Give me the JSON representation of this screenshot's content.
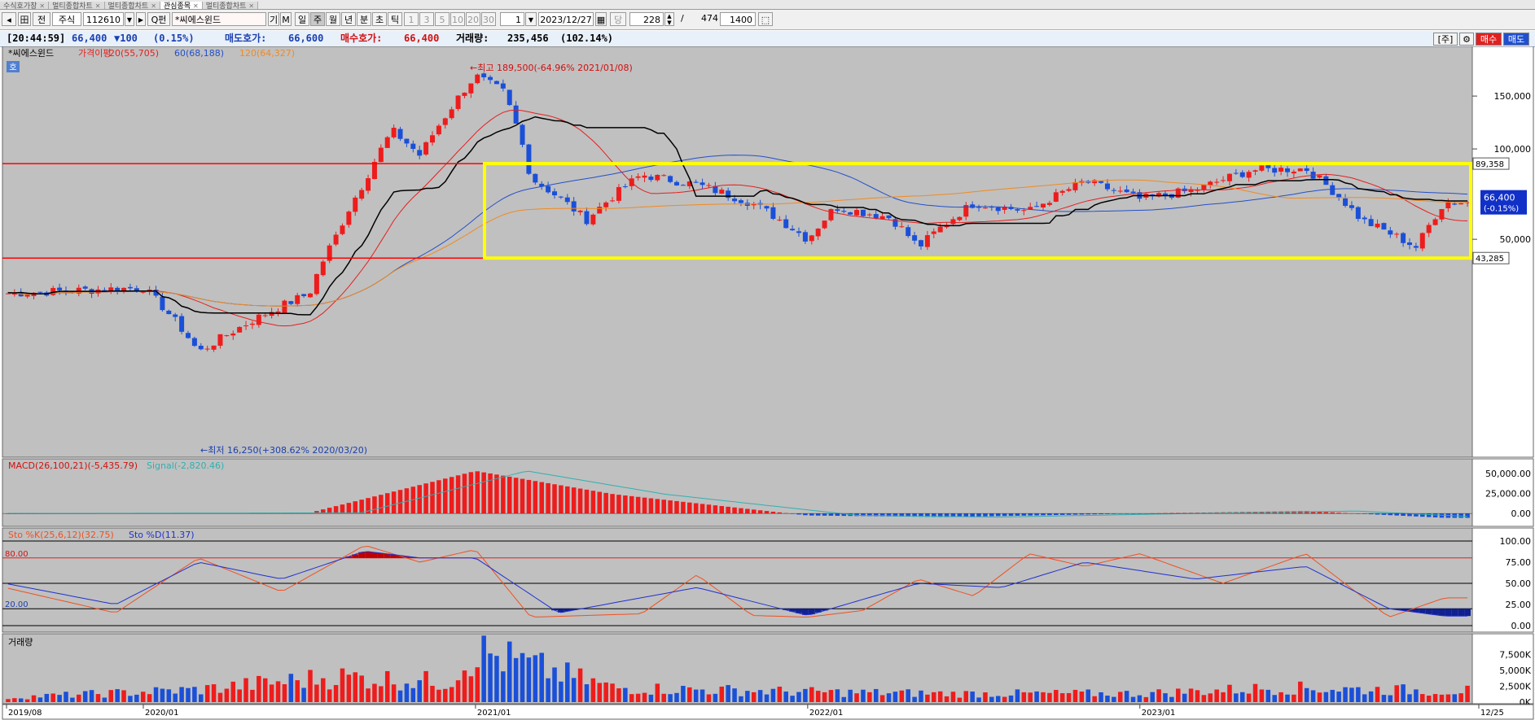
{
  "tabs": [
    {
      "label": "수식호가창"
    },
    {
      "label": "멀티종합차트"
    },
    {
      "label": "멀티종합차트"
    },
    {
      "label": "관심종목"
    },
    {
      "label": "멀티종합차트"
    }
  ],
  "toolbar": {
    "pin": "◂",
    "symbol_icon": "田",
    "prev_label": "전",
    "market": "주식",
    "code": "112610",
    "search_label": "Q펀",
    "stock_name": "*씨에스윈드",
    "ki": "기",
    "m": "M",
    "periods": [
      "일",
      "주",
      "월",
      "년",
      "분",
      "초",
      "틱"
    ],
    "period_selected": "주",
    "minute_options": [
      "1",
      "3",
      "5",
      "10",
      "20",
      "30"
    ],
    "interval_value": "1",
    "date": "2023/12/27",
    "dang": "당",
    "count": "228",
    "slash": "/",
    "total": "474",
    "bars": "1400"
  },
  "info": {
    "time": "[20:44:59]",
    "price": "66,400",
    "change": "▼100",
    "change_pct": "(0.15%)",
    "ask_label": "매도호가:",
    "ask": "66,600",
    "bid_label": "매수호가:",
    "bid": "66,400",
    "volume_label": "거래량:",
    "volume": "235,456",
    "volume_pct": "(102.14%)",
    "bracket_label": "[주]",
    "buy_label": "매수",
    "sell_label": "매도"
  },
  "colors": {
    "up": "#ee1c1c",
    "down": "#1a4fd8",
    "ma20": "#e51f1f",
    "ma60": "#2450c8",
    "ma120": "#f08a20",
    "highlight": "#ffff00",
    "level_line": "#ff0000",
    "background": "#c0c0c0"
  },
  "chart_data": [
    {
      "type": "candlestick",
      "title": "*씨에스윈드",
      "ho_badge": "호",
      "legend": [
        {
          "label": "가격이평",
          "color": "#e51f1f"
        },
        {
          "label": "20(55,705)",
          "color": "#e51f1f"
        },
        {
          "label": "60(68,188)",
          "color": "#2450c8"
        },
        {
          "label": "120(64,327)",
          "color": "#f08a20"
        }
      ],
      "y_ticks": [
        150000,
        100000,
        50000
      ],
      "y_tick_labels": [
        "150,000",
        "100,000",
        "50,000"
      ],
      "ylim": [
        10000,
        200000
      ],
      "y_scale": "log",
      "high_annotation": "←최고 189,500(-64.96% 2021/01/08)",
      "low_annotation": "←최저 16,250(+308.62% 2020/03/20)",
      "level_lines": [
        89358,
        43285
      ],
      "level_labels": [
        "89,358",
        "43,285"
      ],
      "current_price_label": "66,400",
      "current_change_label": "(-0.15%)",
      "x_range": [
        "2019/08",
        "2023/12"
      ],
      "x_ticks": [
        "2019/08",
        "2020/01",
        "2021/01",
        "2022/01",
        "2023/01",
        "12/25"
      ],
      "anchor_points": [
        {
          "date": "2019/08",
          "price": 33000
        },
        {
          "date": "2020/01",
          "price": 34500
        },
        {
          "date": "2020/03",
          "price": 21000
        },
        {
          "date": "2020/05",
          "price": 27000
        },
        {
          "date": "2020/07",
          "price": 33000
        },
        {
          "date": "2020/08",
          "price": 52000
        },
        {
          "date": "2020/09",
          "price": 78000
        },
        {
          "date": "2020/10",
          "price": 115000
        },
        {
          "date": "2020/11",
          "price": 95000
        },
        {
          "date": "2020/12",
          "price": 132000
        },
        {
          "date": "2021/01",
          "price": 175000
        },
        {
          "date": "2021/02",
          "price": 155000
        },
        {
          "date": "2021/03",
          "price": 80000
        },
        {
          "date": "2021/05",
          "price": 58000
        },
        {
          "date": "2021/07",
          "price": 82000
        },
        {
          "date": "2021/09",
          "price": 76000
        },
        {
          "date": "2021/11",
          "price": 66000
        },
        {
          "date": "2022/01",
          "price": 50000
        },
        {
          "date": "2022/02",
          "price": 64000
        },
        {
          "date": "2022/04",
          "price": 59000
        },
        {
          "date": "2022/05",
          "price": 47000
        },
        {
          "date": "2022/07",
          "price": 66000
        },
        {
          "date": "2022/09",
          "price": 62000
        },
        {
          "date": "2022/11",
          "price": 78000
        },
        {
          "date": "2023/01",
          "price": 68000
        },
        {
          "date": "2023/03",
          "price": 73000
        },
        {
          "date": "2023/05",
          "price": 85000
        },
        {
          "date": "2023/07",
          "price": 86000
        },
        {
          "date": "2023/09",
          "price": 58000
        },
        {
          "date": "2023/11",
          "price": 47000
        },
        {
          "date": "2023/12",
          "price": 66400
        }
      ]
    },
    {
      "type": "bar",
      "title": "MACD(26,100,21)(-5,435.79)",
      "signal_label": "Signal(-2,820.46)",
      "y_ticks": [
        "50,000.00",
        "25,000.00",
        "0.00"
      ],
      "ylim": [
        -10000,
        60000
      ],
      "anchor_points": [
        {
          "date": "2019/08",
          "value": 0
        },
        {
          "date": "2020/07",
          "value": 800
        },
        {
          "date": "2021/01",
          "value": 53000
        },
        {
          "date": "2021/06",
          "value": 24000
        },
        {
          "date": "2022/01",
          "value": -2500
        },
        {
          "date": "2022/06",
          "value": -4500
        },
        {
          "date": "2023/01",
          "value": 0
        },
        {
          "date": "2023/07",
          "value": 3000
        },
        {
          "date": "2023/12",
          "value": -5435.79
        }
      ]
    },
    {
      "type": "line",
      "title": "Sto %K(25,6,12)(32.75)",
      "d_label": "Sto %D(11.37)",
      "y_ticks": [
        "100.00",
        "75.00",
        "50.00",
        "25.00",
        "0.00"
      ],
      "level_labels": [
        "80.00",
        "20.00"
      ],
      "ylim": [
        0,
        100
      ],
      "series": [
        {
          "name": "Sto %K(25,6,12)",
          "points": [
            {
              "date": "2019/08",
              "value": 45
            },
            {
              "date": "2019/12",
              "value": 15
            },
            {
              "date": "2020/03",
              "value": 80
            },
            {
              "date": "2020/06",
              "value": 40
            },
            {
              "date": "2020/09",
              "value": 95
            },
            {
              "date": "2020/11",
              "value": 75
            },
            {
              "date": "2021/01",
              "value": 90
            },
            {
              "date": "2021/03",
              "value": 10
            },
            {
              "date": "2021/07",
              "value": 14
            },
            {
              "date": "2021/09",
              "value": 60
            },
            {
              "date": "2021/11",
              "value": 12
            },
            {
              "date": "2022/01",
              "value": 10
            },
            {
              "date": "2022/03",
              "value": 18
            },
            {
              "date": "2022/05",
              "value": 55
            },
            {
              "date": "2022/07",
              "value": 35
            },
            {
              "date": "2022/09",
              "value": 85
            },
            {
              "date": "2022/11",
              "value": 70
            },
            {
              "date": "2023/01",
              "value": 85
            },
            {
              "date": "2023/04",
              "value": 50
            },
            {
              "date": "2023/07",
              "value": 85
            },
            {
              "date": "2023/10",
              "value": 10
            },
            {
              "date": "2023/12",
              "value": 32.75
            }
          ]
        },
        {
          "name": "Sto %D",
          "points": [
            {
              "date": "2019/08",
              "value": 50
            },
            {
              "date": "2019/12",
              "value": 25
            },
            {
              "date": "2020/03",
              "value": 75
            },
            {
              "date": "2020/06",
              "value": 55
            },
            {
              "date": "2020/09",
              "value": 88
            },
            {
              "date": "2020/11",
              "value": 80
            },
            {
              "date": "2021/01",
              "value": 80
            },
            {
              "date": "2021/04",
              "value": 15
            },
            {
              "date": "2021/09",
              "value": 45
            },
            {
              "date": "2022/01",
              "value": 12
            },
            {
              "date": "2022/05",
              "value": 50
            },
            {
              "date": "2022/08",
              "value": 45
            },
            {
              "date": "2022/11",
              "value": 75
            },
            {
              "date": "2023/03",
              "value": 55
            },
            {
              "date": "2023/07",
              "value": 70
            },
            {
              "date": "2023/10",
              "value": 20
            },
            {
              "date": "2023/12",
              "value": 11.37
            }
          ]
        }
      ]
    },
    {
      "type": "bar",
      "title": "거래량",
      "y_ticks": [
        "7,500K",
        "5,000K",
        "2,500K",
        "0K"
      ],
      "ylim": [
        0,
        9000
      ],
      "unit": "K shares",
      "anchor_points": [
        {
          "date": "2019/08",
          "value": 800
        },
        {
          "date": "2020/03",
          "value": 2200
        },
        {
          "date": "2020/08",
          "value": 4500
        },
        {
          "date": "2020/12",
          "value": 3500
        },
        {
          "date": "2021/01",
          "value": 9000
        },
        {
          "date": "2021/06",
          "value": 2500
        },
        {
          "date": "2022/01",
          "value": 1800
        },
        {
          "date": "2022/06",
          "value": 1500
        },
        {
          "date": "2023/01",
          "value": 1500
        },
        {
          "date": "2023/06",
          "value": 2500
        },
        {
          "date": "2023/12",
          "value": 2000
        }
      ]
    }
  ]
}
